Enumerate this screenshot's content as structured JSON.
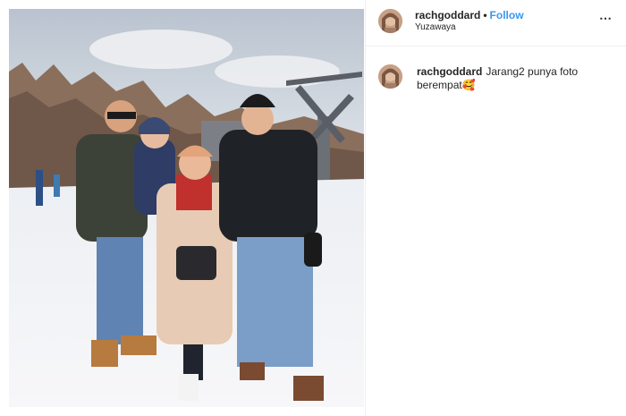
{
  "post": {
    "username": "rachgoddard",
    "separator": "•",
    "follow_label": "Follow",
    "location": "Yuzawaya",
    "more_icon": "more-horizontal-icon",
    "more_glyph": "⋯"
  },
  "comment": {
    "username": "rachgoddard",
    "text": "Jarang2 punya foto berempat🥰"
  },
  "colors": {
    "follow": "#3897f0",
    "text": "#262626",
    "divider": "#efefef"
  }
}
